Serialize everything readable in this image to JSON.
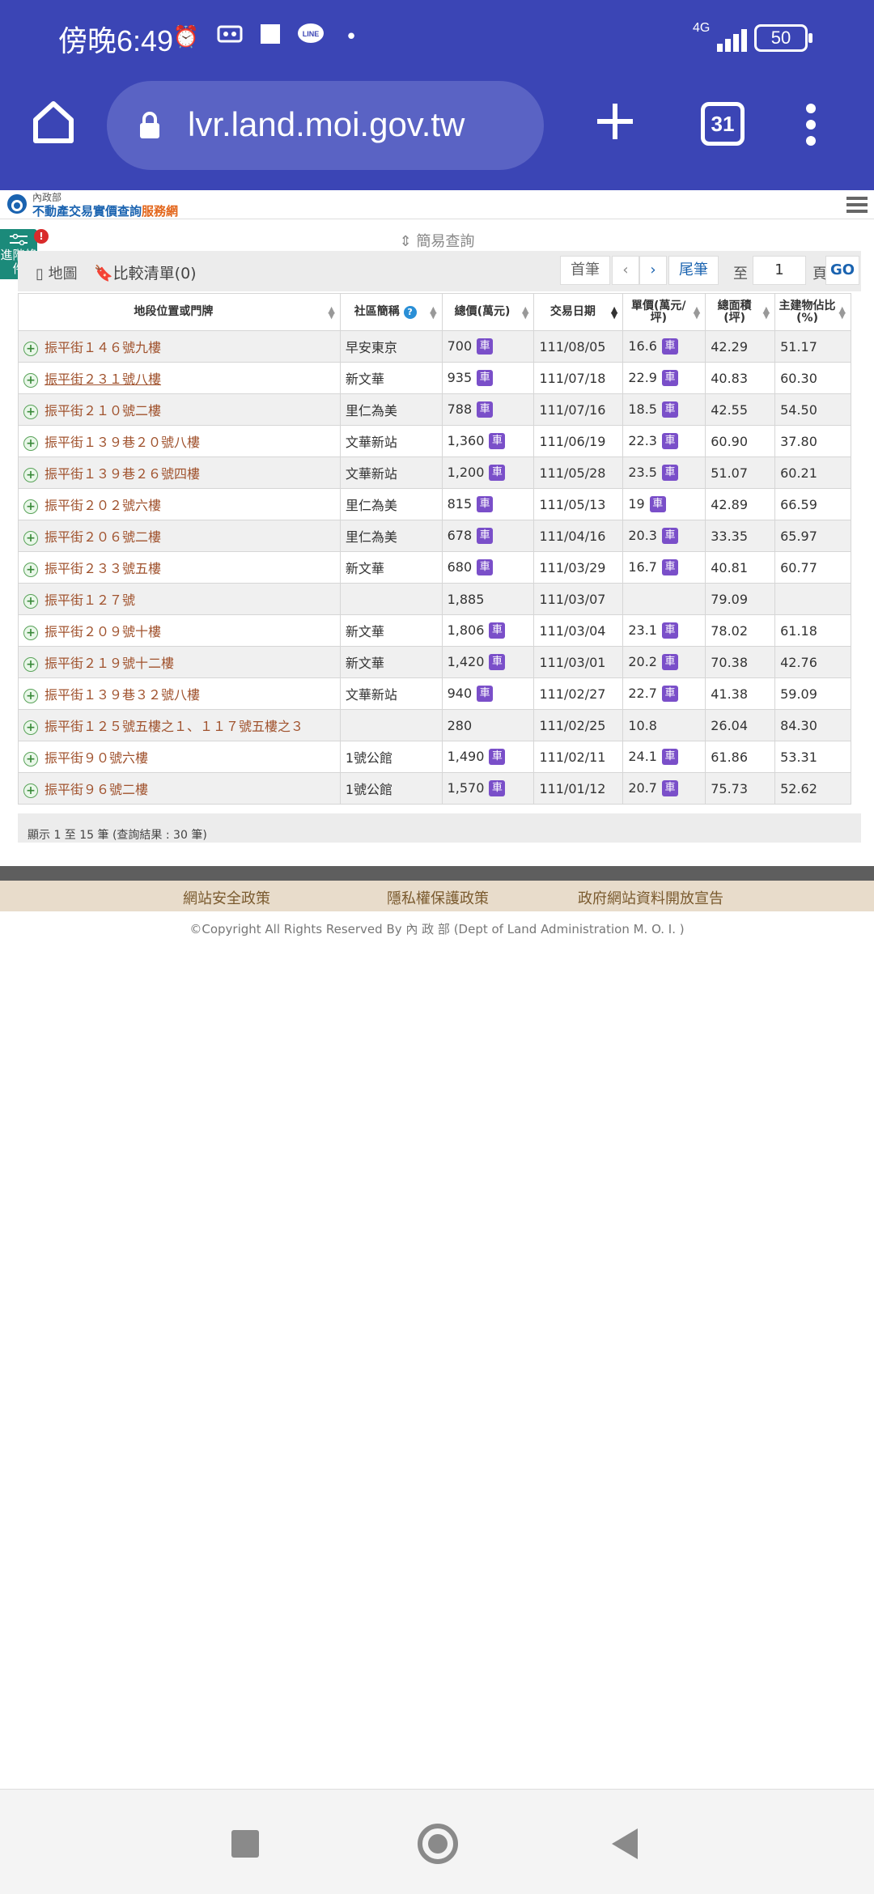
{
  "status_bar": {
    "time": "傍晚6:49",
    "network": "4G",
    "battery": "50"
  },
  "browser": {
    "url": "lvr.land.moi.gov.tw",
    "tab_count": "31"
  },
  "site": {
    "logo_small": "內政部",
    "logo_main": "不動產交易實價查詢",
    "logo_accent": "服務網"
  },
  "filter": {
    "tab_label": "進階條件",
    "badge": "!"
  },
  "query_mode": "簡易查詢",
  "toolbar": {
    "map_label": "地圖",
    "compare_label": "比較清單(0)",
    "first": "首筆",
    "prev": "‹",
    "next": "›",
    "last": "尾筆",
    "to": "至",
    "page_value": "1",
    "page_unit": "頁",
    "go": "GO"
  },
  "table": {
    "headers": [
      "地段位置或門牌",
      "社區簡稱",
      "總價(萬元)",
      "交易日期",
      "單價(萬元/坪)",
      "總面積(坪)",
      "主建物佔比(%)"
    ],
    "car_label": "車",
    "rows": [
      {
        "addr": "振平街１４６號九樓",
        "community": "早安東京",
        "total": "700",
        "total_car": true,
        "date": "111/08/05",
        "unit": "16.6",
        "unit_car": true,
        "area": "42.29",
        "ratio": "51.17"
      },
      {
        "addr": "振平街２３１號八樓",
        "community": "新文華",
        "total": "935",
        "total_car": true,
        "date": "111/07/18",
        "unit": "22.9",
        "unit_car": true,
        "area": "40.83",
        "ratio": "60.30"
      },
      {
        "addr": "振平街２１０號二樓",
        "community": "里仁為美",
        "total": "788",
        "total_car": true,
        "date": "111/07/16",
        "unit": "18.5",
        "unit_car": true,
        "area": "42.55",
        "ratio": "54.50"
      },
      {
        "addr": "振平街１３９巷２０號八樓",
        "community": "文華新站",
        "total": "1,360",
        "total_car": true,
        "date": "111/06/19",
        "unit": "22.3",
        "unit_car": true,
        "area": "60.90",
        "ratio": "37.80"
      },
      {
        "addr": "振平街１３９巷２６號四樓",
        "community": "文華新站",
        "total": "1,200",
        "total_car": true,
        "date": "111/05/28",
        "unit": "23.5",
        "unit_car": true,
        "area": "51.07",
        "ratio": "60.21"
      },
      {
        "addr": "振平街２０２號六樓",
        "community": "里仁為美",
        "total": "815",
        "total_car": true,
        "date": "111/05/13",
        "unit": "19",
        "unit_car": true,
        "area": "42.89",
        "ratio": "66.59"
      },
      {
        "addr": "振平街２０６號二樓",
        "community": "里仁為美",
        "total": "678",
        "total_car": true,
        "date": "111/04/16",
        "unit": "20.3",
        "unit_car": true,
        "area": "33.35",
        "ratio": "65.97"
      },
      {
        "addr": "振平街２３３號五樓",
        "community": "新文華",
        "total": "680",
        "total_car": true,
        "date": "111/03/29",
        "unit": "16.7",
        "unit_car": true,
        "area": "40.81",
        "ratio": "60.77"
      },
      {
        "addr": "振平街１２７號",
        "community": "",
        "total": "1,885",
        "total_car": false,
        "date": "111/03/07",
        "unit": "",
        "unit_car": false,
        "area": "79.09",
        "ratio": ""
      },
      {
        "addr": "振平街２０９號十樓",
        "community": "新文華",
        "total": "1,806",
        "total_car": true,
        "date": "111/03/04",
        "unit": "23.1",
        "unit_car": true,
        "area": "78.02",
        "ratio": "61.18"
      },
      {
        "addr": "振平街２１９號十二樓",
        "community": "新文華",
        "total": "1,420",
        "total_car": true,
        "date": "111/03/01",
        "unit": "20.2",
        "unit_car": true,
        "area": "70.38",
        "ratio": "42.76"
      },
      {
        "addr": "振平街１３９巷３２號八樓",
        "community": "文華新站",
        "total": "940",
        "total_car": true,
        "date": "111/02/27",
        "unit": "22.7",
        "unit_car": true,
        "area": "41.38",
        "ratio": "59.09"
      },
      {
        "addr": "振平街１２５號五樓之１、１１７號五樓之３",
        "community": "",
        "total": "280",
        "total_car": false,
        "date": "111/02/25",
        "unit": "10.8",
        "unit_car": false,
        "area": "26.04",
        "ratio": "84.30"
      },
      {
        "addr": "振平街９０號六樓",
        "community": "1號公館",
        "total": "1,490",
        "total_car": true,
        "date": "111/02/11",
        "unit": "24.1",
        "unit_car": true,
        "area": "61.86",
        "ratio": "53.31"
      },
      {
        "addr": "振平街９６號二樓",
        "community": "1號公館",
        "total": "1,570",
        "total_car": true,
        "date": "111/01/12",
        "unit": "20.7",
        "unit_car": true,
        "area": "75.73",
        "ratio": "52.62"
      }
    ]
  },
  "result_summary": "顯示 1 至 15 筆 (查詢結果 : 30 筆)",
  "footer": {
    "links": [
      "網站安全政策",
      "隱私權保護政策",
      "政府網站資料開放宣告"
    ],
    "copyright": "©Copyright All Rights Reserved By 內 政 部 (Dept of Land Administration M. O. I. )"
  }
}
